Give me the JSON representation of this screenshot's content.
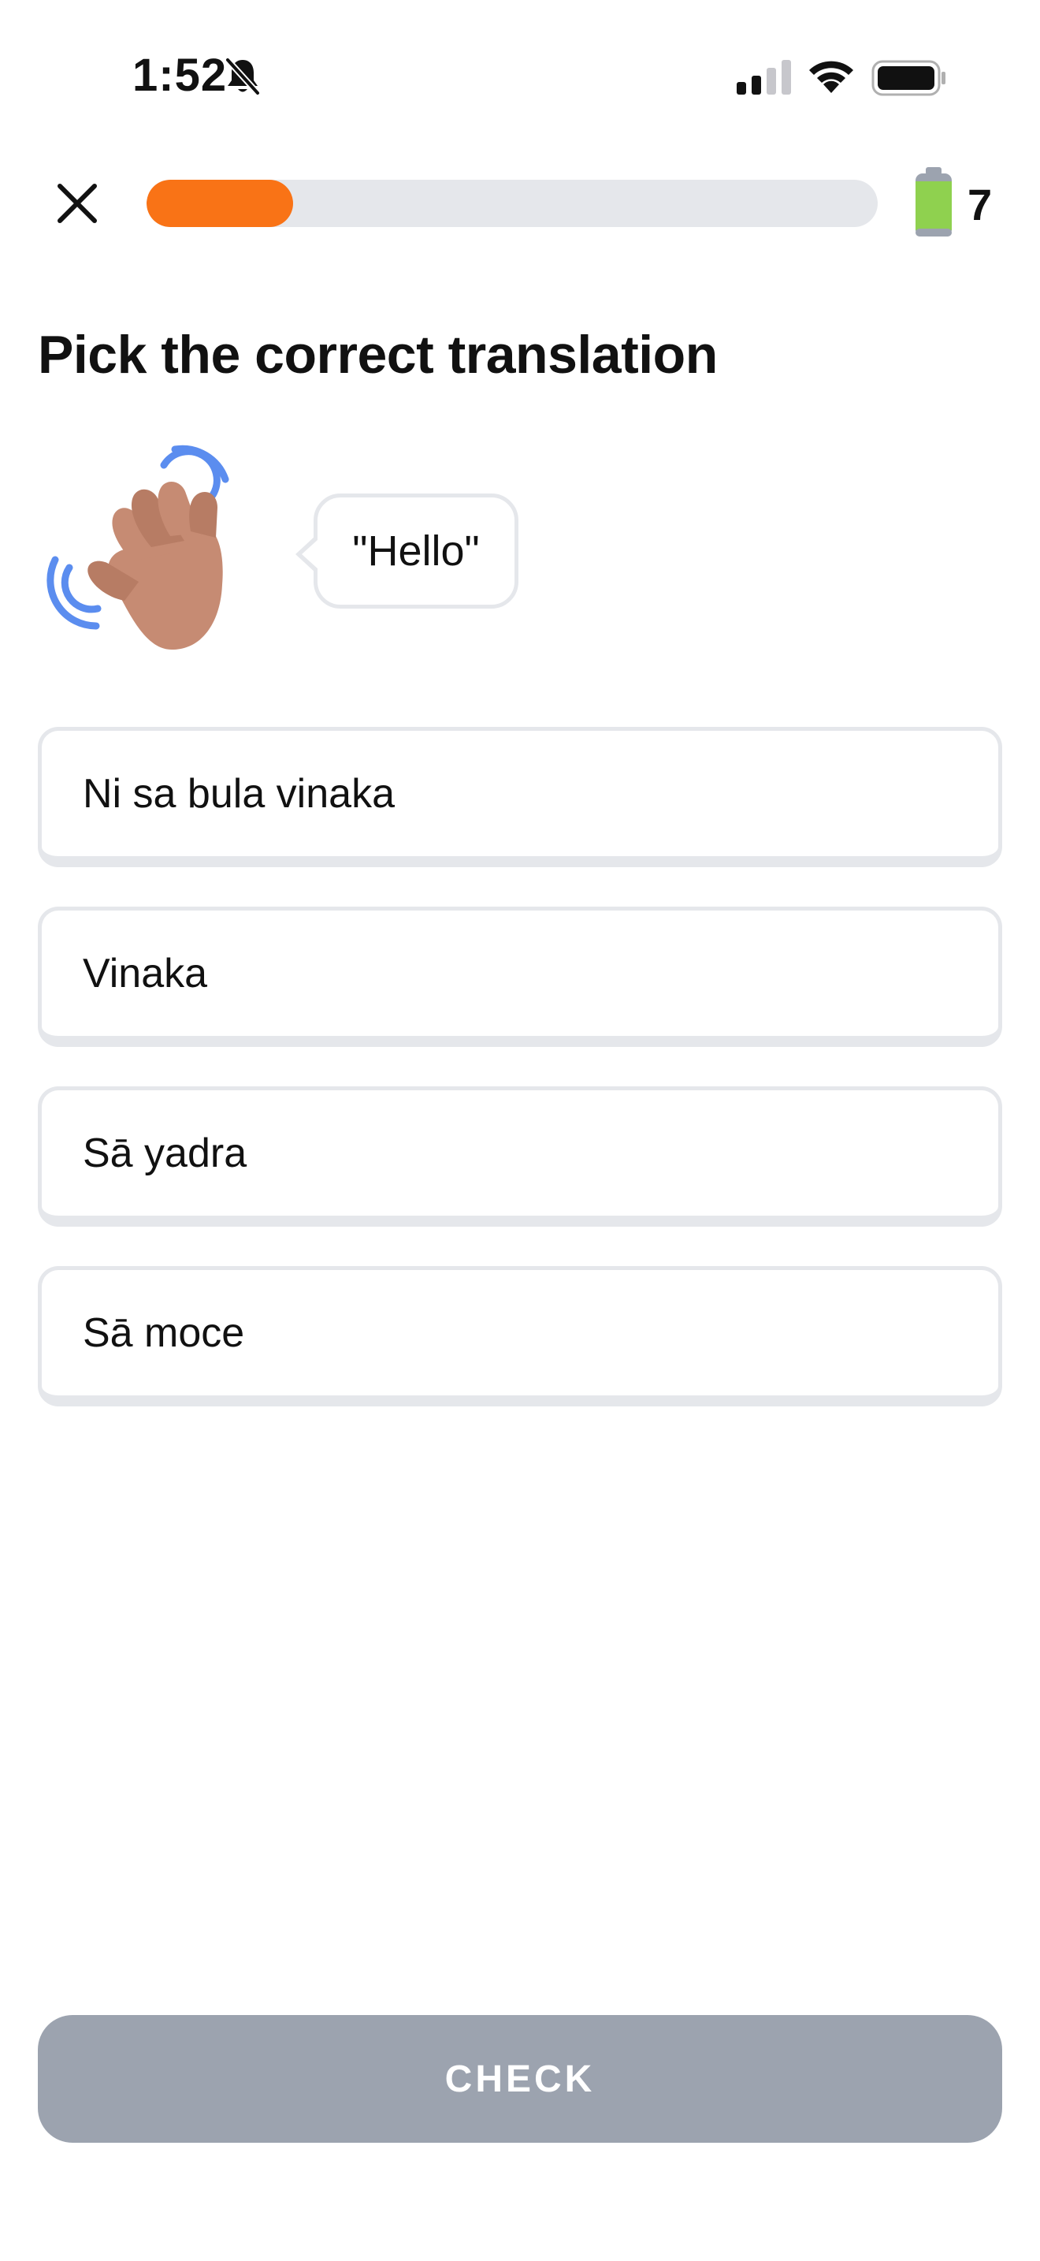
{
  "status_bar": {
    "time": "1:52",
    "icons": [
      "bell-off-icon",
      "signal-icon",
      "wifi-icon",
      "battery-icon"
    ]
  },
  "lesson_bar": {
    "close_icon": "close-icon",
    "progress_fraction": 0.2,
    "progress_color": "#f97316",
    "track_color": "#e5e7eb",
    "energy_icon": "energy-battery-icon",
    "energy_count": "7"
  },
  "prompt": {
    "title": "Pick the correct translation",
    "illustration_icon": "waving-hand-icon",
    "phrase": "\"Hello\""
  },
  "options": [
    {
      "label": "Ni sa bula vinaka"
    },
    {
      "label": "Vinaka"
    },
    {
      "label": "Sā yadra"
    },
    {
      "label": "Sā moce"
    }
  ],
  "check_button": {
    "label": "CHECK",
    "state": "disabled",
    "color": "#9ca3af"
  }
}
